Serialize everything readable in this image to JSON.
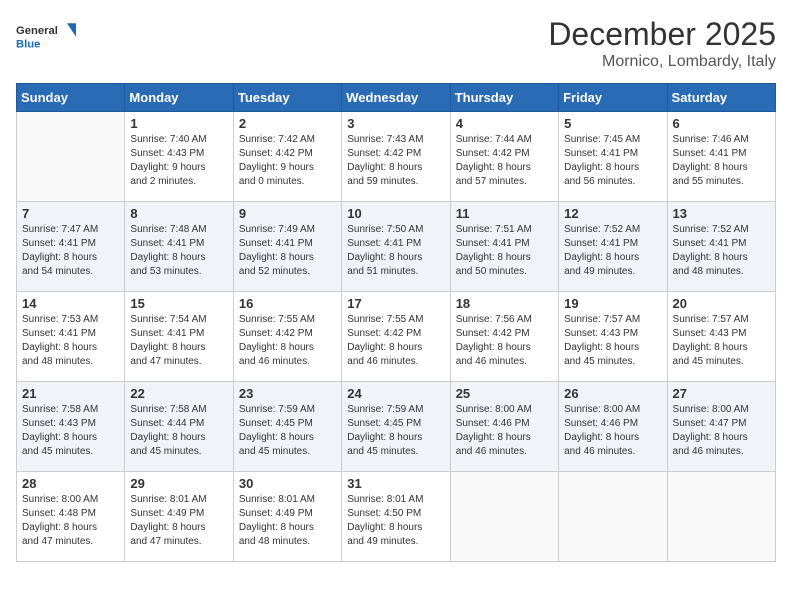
{
  "logo": {
    "general": "General",
    "blue": "Blue"
  },
  "title": "December 2025",
  "subtitle": "Mornico, Lombardy, Italy",
  "weekdays": [
    "Sunday",
    "Monday",
    "Tuesday",
    "Wednesday",
    "Thursday",
    "Friday",
    "Saturday"
  ],
  "weeks": [
    [
      {
        "day": "",
        "info": ""
      },
      {
        "day": "1",
        "info": "Sunrise: 7:40 AM\nSunset: 4:43 PM\nDaylight: 9 hours\nand 2 minutes."
      },
      {
        "day": "2",
        "info": "Sunrise: 7:42 AM\nSunset: 4:42 PM\nDaylight: 9 hours\nand 0 minutes."
      },
      {
        "day": "3",
        "info": "Sunrise: 7:43 AM\nSunset: 4:42 PM\nDaylight: 8 hours\nand 59 minutes."
      },
      {
        "day": "4",
        "info": "Sunrise: 7:44 AM\nSunset: 4:42 PM\nDaylight: 8 hours\nand 57 minutes."
      },
      {
        "day": "5",
        "info": "Sunrise: 7:45 AM\nSunset: 4:41 PM\nDaylight: 8 hours\nand 56 minutes."
      },
      {
        "day": "6",
        "info": "Sunrise: 7:46 AM\nSunset: 4:41 PM\nDaylight: 8 hours\nand 55 minutes."
      }
    ],
    [
      {
        "day": "7",
        "info": "Sunrise: 7:47 AM\nSunset: 4:41 PM\nDaylight: 8 hours\nand 54 minutes."
      },
      {
        "day": "8",
        "info": "Sunrise: 7:48 AM\nSunset: 4:41 PM\nDaylight: 8 hours\nand 53 minutes."
      },
      {
        "day": "9",
        "info": "Sunrise: 7:49 AM\nSunset: 4:41 PM\nDaylight: 8 hours\nand 52 minutes."
      },
      {
        "day": "10",
        "info": "Sunrise: 7:50 AM\nSunset: 4:41 PM\nDaylight: 8 hours\nand 51 minutes."
      },
      {
        "day": "11",
        "info": "Sunrise: 7:51 AM\nSunset: 4:41 PM\nDaylight: 8 hours\nand 50 minutes."
      },
      {
        "day": "12",
        "info": "Sunrise: 7:52 AM\nSunset: 4:41 PM\nDaylight: 8 hours\nand 49 minutes."
      },
      {
        "day": "13",
        "info": "Sunrise: 7:52 AM\nSunset: 4:41 PM\nDaylight: 8 hours\nand 48 minutes."
      }
    ],
    [
      {
        "day": "14",
        "info": "Sunrise: 7:53 AM\nSunset: 4:41 PM\nDaylight: 8 hours\nand 48 minutes."
      },
      {
        "day": "15",
        "info": "Sunrise: 7:54 AM\nSunset: 4:41 PM\nDaylight: 8 hours\nand 47 minutes."
      },
      {
        "day": "16",
        "info": "Sunrise: 7:55 AM\nSunset: 4:42 PM\nDaylight: 8 hours\nand 46 minutes."
      },
      {
        "day": "17",
        "info": "Sunrise: 7:55 AM\nSunset: 4:42 PM\nDaylight: 8 hours\nand 46 minutes."
      },
      {
        "day": "18",
        "info": "Sunrise: 7:56 AM\nSunset: 4:42 PM\nDaylight: 8 hours\nand 46 minutes."
      },
      {
        "day": "19",
        "info": "Sunrise: 7:57 AM\nSunset: 4:43 PM\nDaylight: 8 hours\nand 45 minutes."
      },
      {
        "day": "20",
        "info": "Sunrise: 7:57 AM\nSunset: 4:43 PM\nDaylight: 8 hours\nand 45 minutes."
      }
    ],
    [
      {
        "day": "21",
        "info": "Sunrise: 7:58 AM\nSunset: 4:43 PM\nDaylight: 8 hours\nand 45 minutes."
      },
      {
        "day": "22",
        "info": "Sunrise: 7:58 AM\nSunset: 4:44 PM\nDaylight: 8 hours\nand 45 minutes."
      },
      {
        "day": "23",
        "info": "Sunrise: 7:59 AM\nSunset: 4:45 PM\nDaylight: 8 hours\nand 45 minutes."
      },
      {
        "day": "24",
        "info": "Sunrise: 7:59 AM\nSunset: 4:45 PM\nDaylight: 8 hours\nand 45 minutes."
      },
      {
        "day": "25",
        "info": "Sunrise: 8:00 AM\nSunset: 4:46 PM\nDaylight: 8 hours\nand 46 minutes."
      },
      {
        "day": "26",
        "info": "Sunrise: 8:00 AM\nSunset: 4:46 PM\nDaylight: 8 hours\nand 46 minutes."
      },
      {
        "day": "27",
        "info": "Sunrise: 8:00 AM\nSunset: 4:47 PM\nDaylight: 8 hours\nand 46 minutes."
      }
    ],
    [
      {
        "day": "28",
        "info": "Sunrise: 8:00 AM\nSunset: 4:48 PM\nDaylight: 8 hours\nand 47 minutes."
      },
      {
        "day": "29",
        "info": "Sunrise: 8:01 AM\nSunset: 4:49 PM\nDaylight: 8 hours\nand 47 minutes."
      },
      {
        "day": "30",
        "info": "Sunrise: 8:01 AM\nSunset: 4:49 PM\nDaylight: 8 hours\nand 48 minutes."
      },
      {
        "day": "31",
        "info": "Sunrise: 8:01 AM\nSunset: 4:50 PM\nDaylight: 8 hours\nand 49 minutes."
      },
      {
        "day": "",
        "info": ""
      },
      {
        "day": "",
        "info": ""
      },
      {
        "day": "",
        "info": ""
      }
    ]
  ]
}
